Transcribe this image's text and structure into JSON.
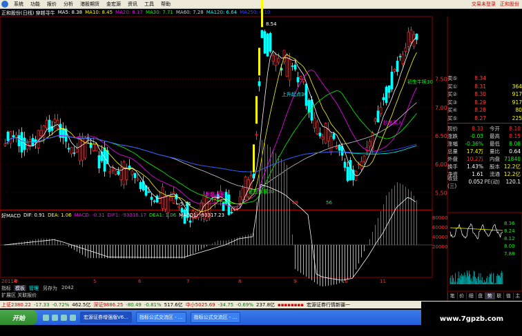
{
  "menu": {
    "items": [
      "系统",
      "功能",
      "报价",
      "分析",
      "港股期货",
      "金宏源",
      "资讯",
      "工具",
      "帮助"
    ],
    "promo": [
      "交易未登录",
      "正和股份"
    ]
  },
  "main": {
    "title": "正和股份(日线) 穿越寻牛",
    "ma": [
      {
        "label": "MA5: 8.38",
        "color": "#ffffff"
      },
      {
        "label": "MA10: 8.45",
        "color": "#ffff00"
      },
      {
        "label": "MA20: 8.17",
        "color": "#ff00ff"
      },
      {
        "label": "MA30: 7.71",
        "color": "#00ff00"
      },
      {
        "label": "MA60: 7.28",
        "color": "#cccccc"
      },
      {
        "label": "MA120: 6.64",
        "color": "#00ffff"
      },
      {
        "label": "MA250: 6.10",
        "color": "#4040ff"
      }
    ],
    "annotations": {
      "high": "8.54",
      "low": "←5.14",
      "buy1": "抄底买入",
      "buy2": "发起上涨",
      "bull1": "初生牛犊30",
      "bull2": "初生牛犊30",
      "n1": "69",
      "n2": "56",
      "ma_sign": "上升起点30"
    }
  },
  "price_axis": [
    "7.50",
    "7.00",
    "6.50",
    "6.00",
    "5.50"
  ],
  "macd": {
    "title": "好MACD",
    "dif": "DIF: 0.91",
    "dea": "DEA: 1.06",
    "macd": "MACD: -0.31",
    "dif1": "DIF1: -93316.17",
    "dea1": "DEA1: 1.06",
    "macd1": "MACD1: -93317.23"
  },
  "dates": [
    "2011年",
    "4",
    "5",
    "6",
    "7",
    "8",
    "9",
    "10",
    "11"
  ],
  "tabs": [
    "指标",
    "模板",
    "管理",
    "另存为",
    "2042"
  ],
  "tab2": "扩展区 关联报价",
  "panel": {
    "asks": [
      [
        "卖⑤",
        "8.34",
        ""
      ],
      [
        "买①",
        "8.31",
        "364"
      ],
      [
        "买②",
        "8.30",
        "917"
      ],
      [
        "买③",
        "8.29",
        "917"
      ],
      [
        "买④",
        "8.28",
        "80"
      ],
      [
        "买⑤",
        "8.27",
        "225"
      ]
    ],
    "quote": [
      [
        "现价",
        "8.33",
        "今开",
        "8.10"
      ],
      [
        "涨跌",
        "-0.03",
        "最高",
        "8.15"
      ],
      [
        "涨幅",
        "-0.36%",
        "最低",
        "8.08"
      ],
      [
        "总量",
        "17.4万",
        "量比",
        "0.64"
      ],
      [
        "外盘",
        "10.2万",
        "内盘",
        "71840"
      ],
      [
        "换手",
        "1.43%",
        "股本",
        "12.2亿"
      ],
      [
        "净资",
        "1.61",
        "流通",
        "12.2亿"
      ],
      [
        "收益(三)",
        "0.052",
        "PE(动)",
        "120.1"
      ]
    ],
    "mini_axis": [
      "80000",
      "60000",
      "40000",
      "20000"
    ],
    "mini_axis2": [
      "8.36",
      "8.24",
      "8.12",
      "8.00",
      "7.88"
    ],
    "fn": [
      "笔",
      "价",
      "细",
      "盘",
      "势",
      "联",
      "值",
      "主"
    ]
  },
  "status": {
    "sh": "上证2380.22",
    "sh_chg": "-17.33",
    "sh_pct": "-0.72%",
    "sh_amt": "462.5亿",
    "sz": "深证9886.25",
    "sz_chg": "-80.49",
    "sz_pct": "-0.81%",
    "sz_amt": "517.6亿",
    "zx": "中小5025.69",
    "zx_chg": "-34.75",
    "zx_pct": "-0.69%",
    "zx_amt": "237.8亿",
    "msg": "宏源证券行情新疆一"
  },
  "taskbar": {
    "start": "开始",
    "tasks": [
      "宏源证券增强版V6...",
      "指标公式交流区 - ...",
      "指标公式交流区 - ..."
    ]
  },
  "watermark": "www.7gpzb.com",
  "colors": {
    "up": "#ff3030",
    "down": "#00ffff",
    "bg": "#000000"
  }
}
